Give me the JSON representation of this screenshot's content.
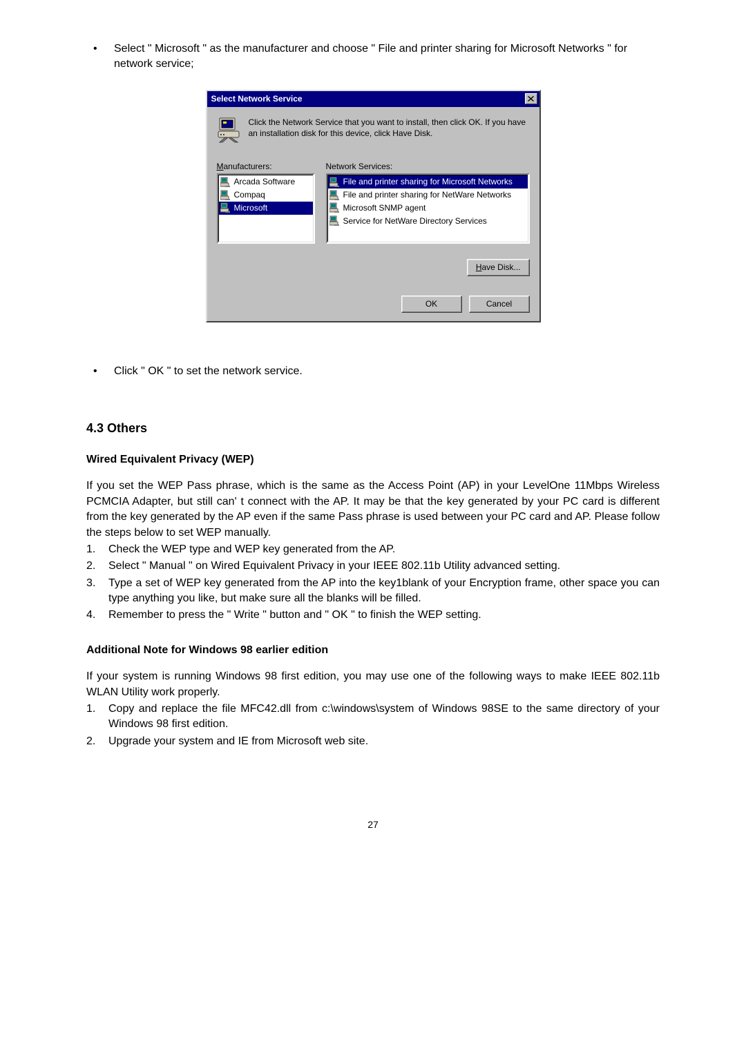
{
  "intro_bullet": "Select  \" Microsoft \" as the manufacturer and choose  \" File and printer sharing for Microsoft Networks \"  for network service;",
  "dialog": {
    "title": "Select Network Service",
    "instruction": "Click the Network Service that you want to install, then click OK. If you have an installation disk for this device, click Have Disk.",
    "manufacturers_label": "Manufacturers:",
    "services_label": "Network Services:",
    "manufacturers": [
      "Arcada Software",
      "Compaq",
      "Microsoft"
    ],
    "services": [
      "File and printer sharing for Microsoft Networks",
      "File and printer sharing for NetWare Networks",
      "Microsoft SNMP agent",
      "Service for NetWare Directory Services"
    ],
    "have_disk": "Have Disk...",
    "ok": "OK",
    "cancel": "Cancel"
  },
  "click_ok_bullet": "Click  \" OK \"  to set the network service.",
  "others_heading": "4.3 Others",
  "wep": {
    "heading": "Wired Equivalent Privacy (WEP)",
    "para": "If you set the WEP Pass phrase, which is the same as the Access Point (AP) in your LevelOne 11Mbps Wireless PCMCIA Adapter, but still can' t connect with the AP. It may be that the key generated by your PC card is different from the key generated by the AP even if the same Pass phrase is used between your PC card and AP. Please follow the steps below to set WEP manually.",
    "items": [
      "Check the WEP type and WEP key generated from the AP.",
      "Select  \" Manual \"  on Wired Equivalent Privacy in your IEEE 802.11b Utility advanced setting.",
      "Type a set of WEP key generated from the AP into the key1blank of your Encryption frame, other space you can type anything you like, but make sure all the blanks will be filled.",
      "Remember to press the  \" Write \"  button and  \" OK \"  to finish the WEP setting."
    ]
  },
  "win98": {
    "heading": "Additional Note for Windows 98 earlier edition",
    "para": "If your system is running Windows 98 first edition, you may use one of the following ways to make IEEE 802.11b WLAN Utility work properly.",
    "items": [
      "Copy and replace the file MFC42.dll from c:\\windows\\system of Windows 98SE to the same directory of your Windows 98 first edition.",
      "Upgrade your system and IE from Microsoft web site."
    ]
  },
  "page_number": "27"
}
